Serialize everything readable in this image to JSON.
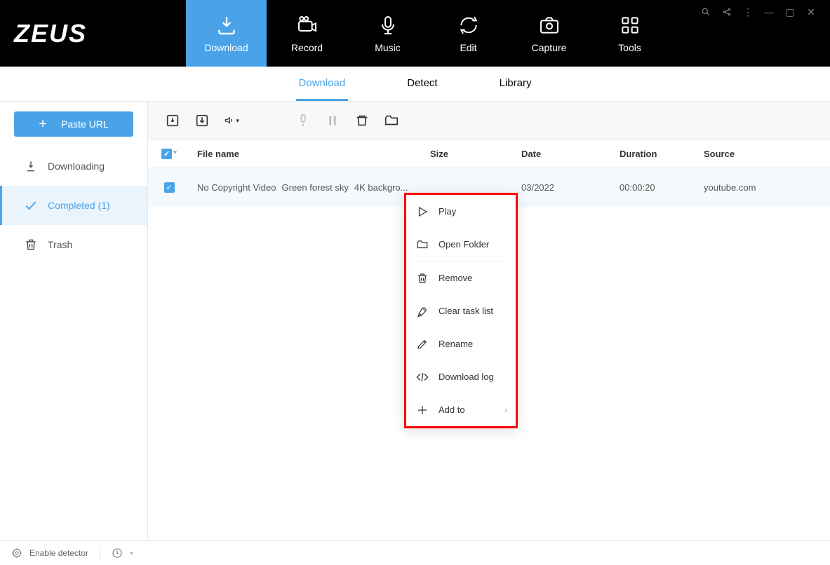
{
  "app": {
    "name": "ZEUS"
  },
  "nav": [
    {
      "label": "Download"
    },
    {
      "label": "Record"
    },
    {
      "label": "Music"
    },
    {
      "label": "Edit"
    },
    {
      "label": "Capture"
    },
    {
      "label": "Tools"
    }
  ],
  "subtabs": [
    {
      "label": "Download"
    },
    {
      "label": "Detect"
    },
    {
      "label": "Library"
    }
  ],
  "sidebar": {
    "paste_label": "Paste URL",
    "items": [
      {
        "label": "Downloading"
      },
      {
        "label": "Completed (1)"
      },
      {
        "label": "Trash"
      }
    ]
  },
  "columns": {
    "name": "File name",
    "size": "Size",
    "date": "Date",
    "duration": "Duration",
    "source": "Source"
  },
  "rows": [
    {
      "name_parts": [
        "No Copyright Video",
        "Green forest sky",
        "4K backgro..."
      ],
      "size": "",
      "date": "03/2022",
      "duration": "00:00:20",
      "source": "youtube.com"
    }
  ],
  "context_menu": [
    {
      "label": "Play"
    },
    {
      "label": "Open Folder"
    },
    {
      "label": "Remove"
    },
    {
      "label": "Clear task list"
    },
    {
      "label": "Rename"
    },
    {
      "label": "Download log"
    },
    {
      "label": "Add to"
    }
  ],
  "statusbar": {
    "detector": "Enable detector"
  }
}
